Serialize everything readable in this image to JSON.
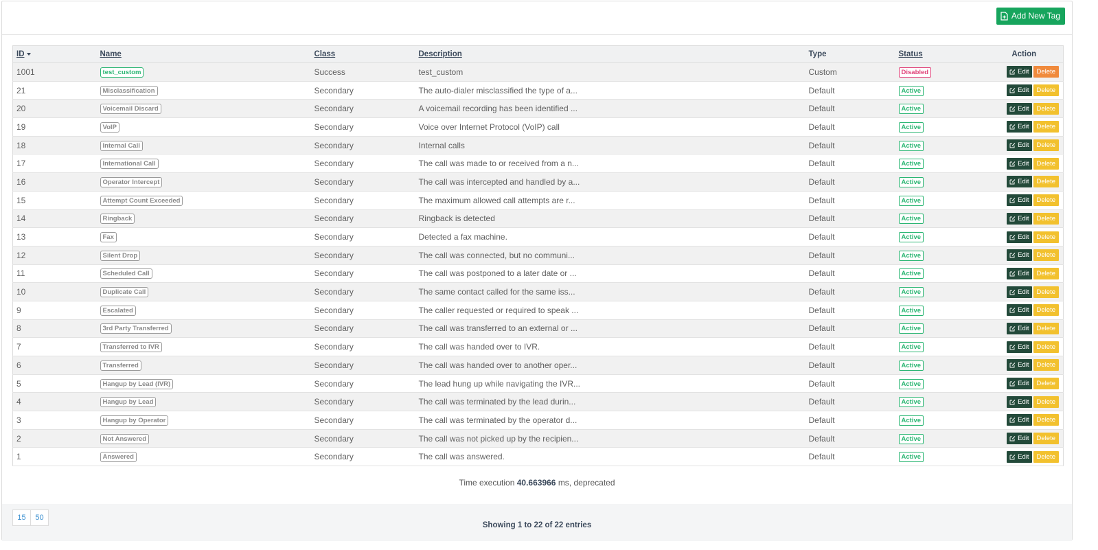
{
  "toolbar": {
    "add_label": "Add New Tag"
  },
  "table": {
    "headers": {
      "id": "ID",
      "name": "Name",
      "class": "Class",
      "description": "Description",
      "type": "Type",
      "status": "Status",
      "action": "Action"
    },
    "edit_label": "Edit",
    "delete_label": "Delete",
    "rows": [
      {
        "id": "1001",
        "name": "test_custom",
        "class": "Success",
        "description": "test_custom",
        "type": "Custom",
        "status": "Disabled"
      },
      {
        "id": "21",
        "name": "Misclassification",
        "class": "Secondary",
        "description": "The auto-dialer misclassified the type of a...",
        "type": "Default",
        "status": "Active"
      },
      {
        "id": "20",
        "name": "Voicemail Discard",
        "class": "Secondary",
        "description": "A voicemail recording has been identified ...",
        "type": "Default",
        "status": "Active"
      },
      {
        "id": "19",
        "name": "VoIP",
        "class": "Secondary",
        "description": "Voice over Internet Protocol (VoIP) call",
        "type": "Default",
        "status": "Active"
      },
      {
        "id": "18",
        "name": "Internal Call",
        "class": "Secondary",
        "description": "Internal calls",
        "type": "Default",
        "status": "Active"
      },
      {
        "id": "17",
        "name": "International Call",
        "class": "Secondary",
        "description": "The call was made to or received from a n...",
        "type": "Default",
        "status": "Active"
      },
      {
        "id": "16",
        "name": "Operator Intercept",
        "class": "Secondary",
        "description": "The call was intercepted and handled by a...",
        "type": "Default",
        "status": "Active"
      },
      {
        "id": "15",
        "name": "Attempt Count Exceeded",
        "class": "Secondary",
        "description": "The maximum allowed call attempts are r...",
        "type": "Default",
        "status": "Active"
      },
      {
        "id": "14",
        "name": "Ringback",
        "class": "Secondary",
        "description": "Ringback is detected",
        "type": "Default",
        "status": "Active"
      },
      {
        "id": "13",
        "name": "Fax",
        "class": "Secondary",
        "description": "Detected a fax machine.",
        "type": "Default",
        "status": "Active"
      },
      {
        "id": "12",
        "name": "Silent Drop",
        "class": "Secondary",
        "description": "The call was connected, but no communi...",
        "type": "Default",
        "status": "Active"
      },
      {
        "id": "11",
        "name": "Scheduled Call",
        "class": "Secondary",
        "description": "The call was postponed to a later date or ...",
        "type": "Default",
        "status": "Active"
      },
      {
        "id": "10",
        "name": "Duplicate Call",
        "class": "Secondary",
        "description": "The same contact called for the same iss...",
        "type": "Default",
        "status": "Active"
      },
      {
        "id": "9",
        "name": "Escalated",
        "class": "Secondary",
        "description": "The caller requested or required to speak ...",
        "type": "Default",
        "status": "Active"
      },
      {
        "id": "8",
        "name": "3rd Party Transferred",
        "class": "Secondary",
        "description": "The call was transferred to an external or ...",
        "type": "Default",
        "status": "Active"
      },
      {
        "id": "7",
        "name": "Transferred to IVR",
        "class": "Secondary",
        "description": "The call was handed over to IVR.",
        "type": "Default",
        "status": "Active"
      },
      {
        "id": "6",
        "name": "Transferred",
        "class": "Secondary",
        "description": "The call was handed over to another oper...",
        "type": "Default",
        "status": "Active"
      },
      {
        "id": "5",
        "name": "Hangup by Lead (IVR)",
        "class": "Secondary",
        "description": "The lead hung up while navigating the IVR...",
        "type": "Default",
        "status": "Active"
      },
      {
        "id": "4",
        "name": "Hangup by Lead",
        "class": "Secondary",
        "description": "The call was terminated by the lead durin...",
        "type": "Default",
        "status": "Active"
      },
      {
        "id": "3",
        "name": "Hangup by Operator",
        "class": "Secondary",
        "description": "The call was terminated by the operator d...",
        "type": "Default",
        "status": "Active"
      },
      {
        "id": "2",
        "name": "Not Answered",
        "class": "Secondary",
        "description": "The call was not picked up by the recipien...",
        "type": "Default",
        "status": "Active"
      },
      {
        "id": "1",
        "name": "Answered",
        "class": "Secondary",
        "description": "The call was answered.",
        "type": "Default",
        "status": "Active"
      }
    ]
  },
  "exec": {
    "prefix": "Time execution",
    "value": "40.663966",
    "suffix": "ms, deprecated"
  },
  "pager": {
    "options": [
      "15",
      "50"
    ]
  },
  "footer": {
    "showing": "Showing 1 to 22 of 22 entries"
  },
  "colors": {
    "primary": "#17a55d",
    "active": "#2bb673",
    "disabled": "#e0457b",
    "edit": "#234a3a",
    "delete": "#f2c12e",
    "delete_hover": "#f08a3c"
  },
  "icons": {
    "add": "file-plus-icon",
    "edit": "edit-icon",
    "sort": "caret-down-icon"
  }
}
